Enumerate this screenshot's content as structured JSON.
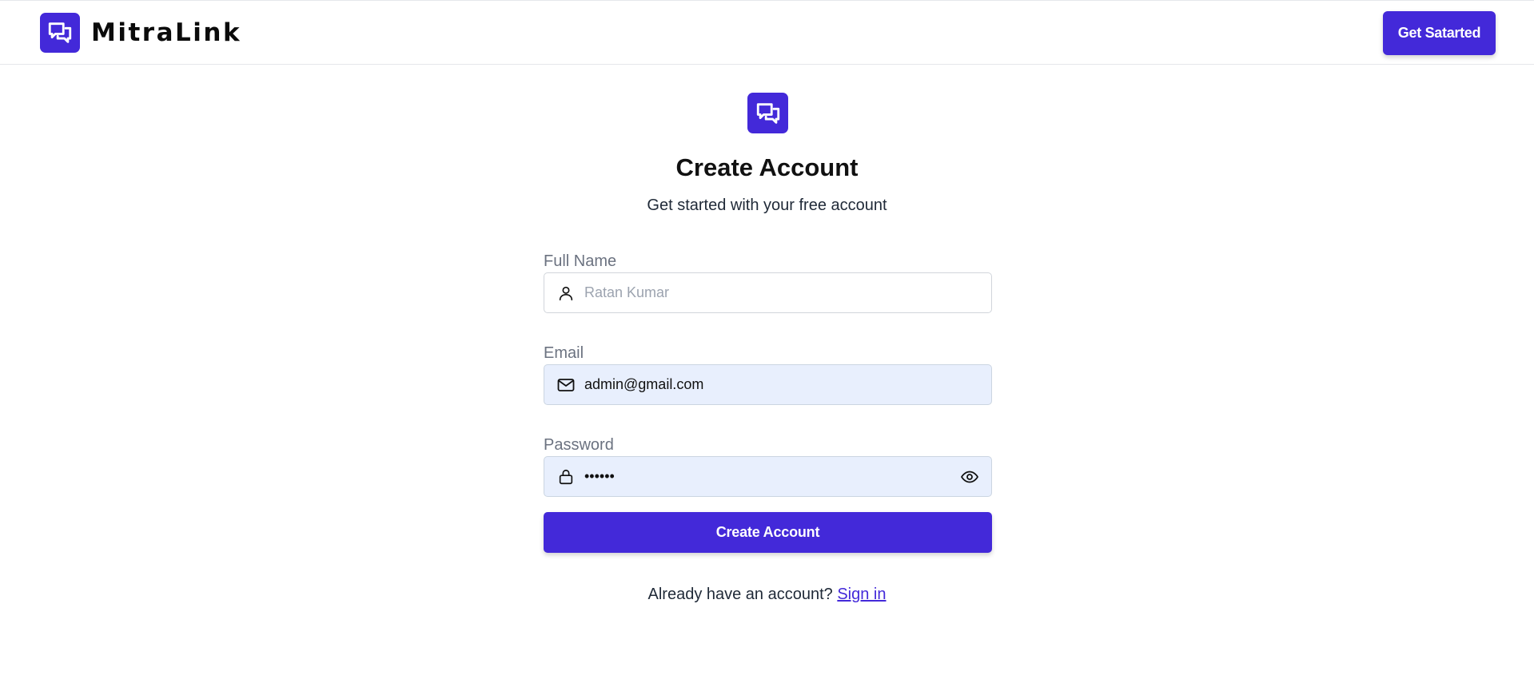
{
  "header": {
    "brand_name": "MitraLink",
    "logo_icon": "chat-bubbles-icon",
    "cta_label": "Get Satarted"
  },
  "hero": {
    "logo_icon": "chat-bubbles-icon",
    "title": "Create Account",
    "subtitle": "Get started with your free account"
  },
  "form": {
    "full_name": {
      "label": "Full Name",
      "placeholder": "Ratan Kumar",
      "value": "",
      "icon": "user-icon"
    },
    "email": {
      "label": "Email",
      "placeholder": "",
      "value": "admin@gmail.com",
      "icon": "mail-icon"
    },
    "password": {
      "label": "Password",
      "value": "••••••",
      "icon": "lock-icon",
      "toggle_icon": "eye-icon"
    },
    "submit_label": "Create Account"
  },
  "footer": {
    "prompt": "Already have an account?",
    "link_label": "Sign in"
  },
  "colors": {
    "accent": "#4329d9",
    "filled_input_bg": "#e8effd",
    "label_gray": "#6b7280"
  }
}
